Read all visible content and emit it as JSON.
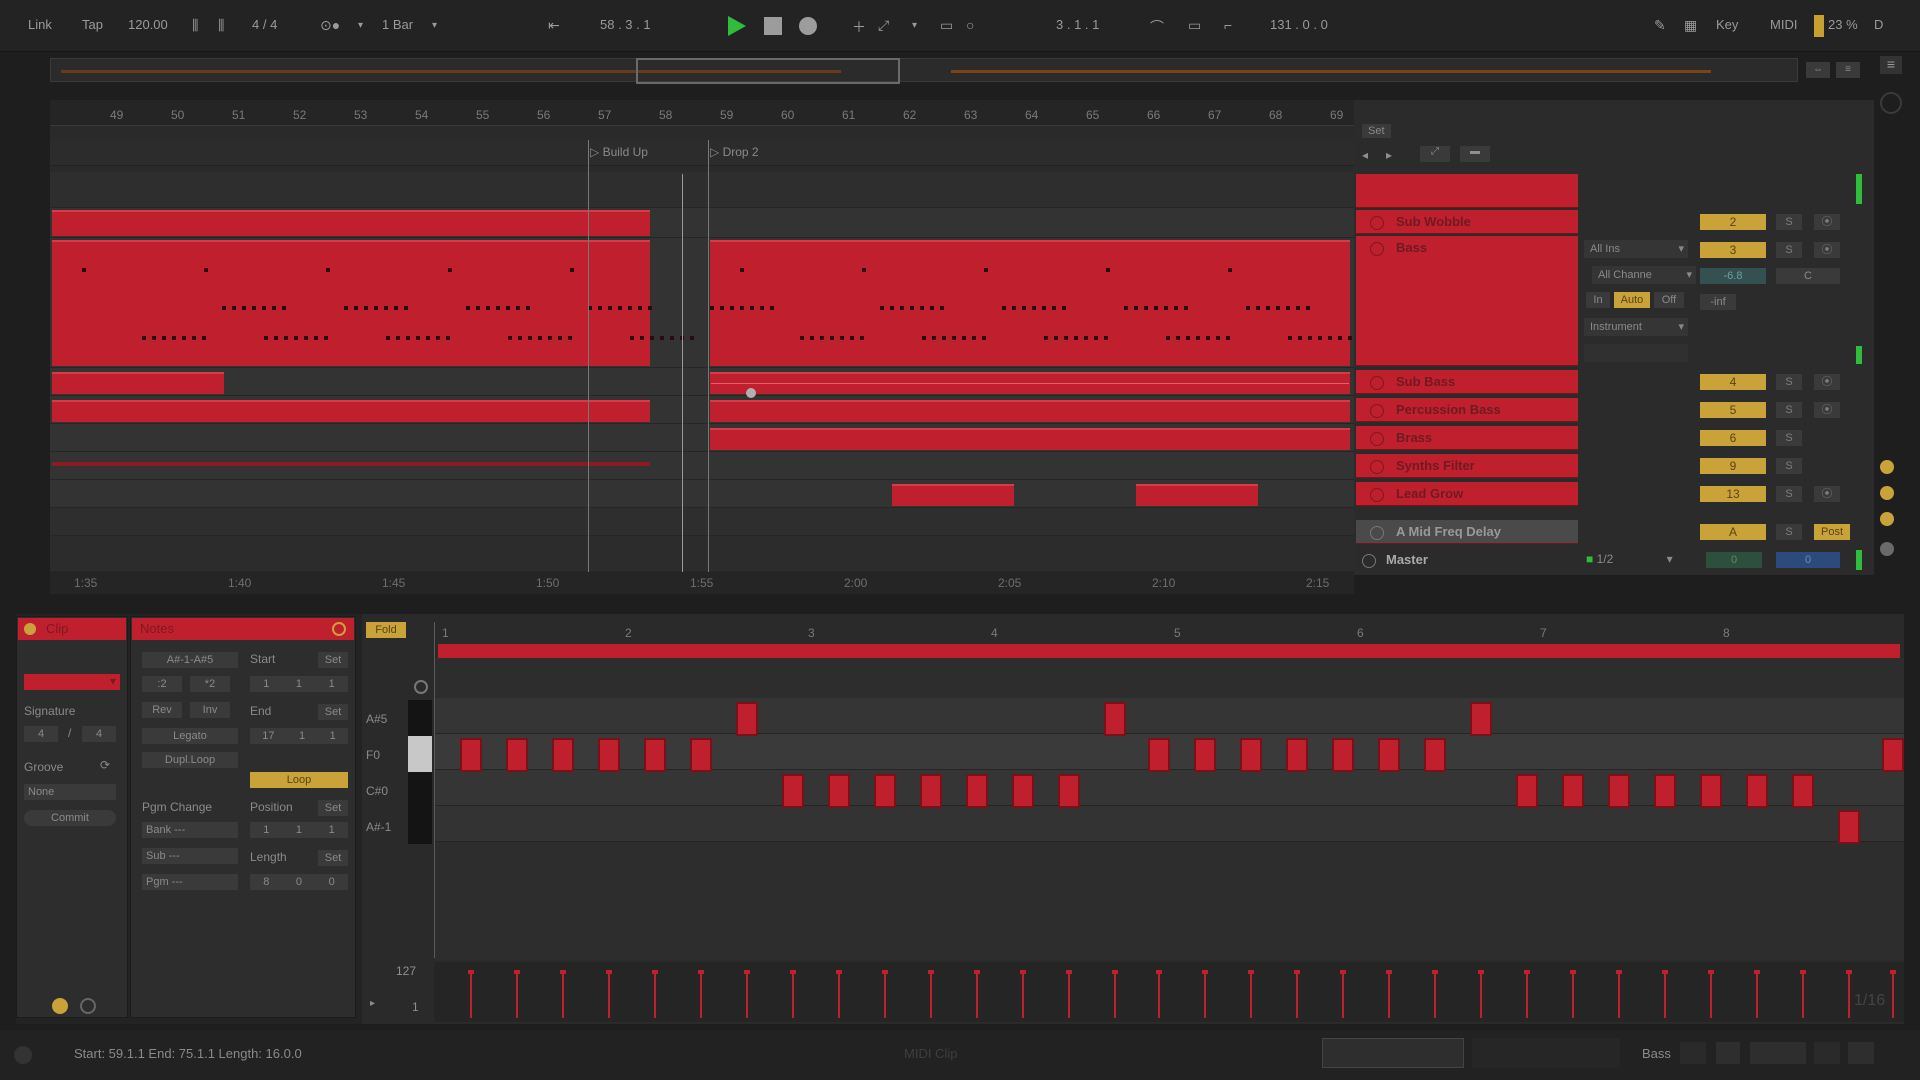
{
  "transport": {
    "link": "Link",
    "tap": "Tap",
    "tempo": "120.00",
    "time_sig": "4 / 4",
    "quantize": "1 Bar",
    "position": "58 .  3 .  1",
    "loop_start": "3 .  1 .  1",
    "loop_length": "131 .  0 .  0",
    "key": "Key",
    "midi": "MIDI",
    "cpu": "23 %",
    "disk": "D"
  },
  "arrangement": {
    "bar_numbers": [
      "49",
      "50",
      "51",
      "52",
      "53",
      "54",
      "55",
      "56",
      "57",
      "58",
      "59",
      "60",
      "61",
      "62",
      "63",
      "64",
      "65",
      "66",
      "67",
      "68",
      "69"
    ],
    "locators": [
      {
        "label": "Build Up"
      },
      {
        "label": "Drop 2"
      }
    ],
    "time_labels": [
      "1:35",
      "1:40",
      "1:45",
      "1:50",
      "1:55",
      "2:00",
      "2:05",
      "2:10",
      "2:15"
    ],
    "set_label": "Set"
  },
  "tracks": [
    {
      "name": "Sub Wobble",
      "number": "2",
      "solo": "S",
      "arm": "⦿"
    },
    {
      "name": "Bass",
      "number": "3",
      "solo": "S",
      "arm": "⦿"
    },
    {
      "name": "Sub Bass",
      "number": "4",
      "solo": "S",
      "arm": "⦿"
    },
    {
      "name": "Percussion Bass",
      "number": "5",
      "solo": "S",
      "arm": "⦿"
    },
    {
      "name": "Brass",
      "number": "6",
      "solo": "S",
      "arm": ""
    },
    {
      "name": "Synths Filter",
      "number": "9",
      "solo": "S",
      "arm": ""
    },
    {
      "name": "Lead Grow",
      "number": "13",
      "solo": "S",
      "arm": "⦿"
    },
    {
      "name": "A Mid Freq Delay",
      "number": "A",
      "solo": "S",
      "arm": "Post"
    }
  ],
  "master": {
    "name": "Master",
    "output": "1/2",
    "volume": "0",
    "pan": "0"
  },
  "bass_io": {
    "input_type": "All Ins",
    "input_channel": "All Channe",
    "monitor_in": "In",
    "monitor_auto": "Auto",
    "monitor_off": "Off",
    "output": "Instrument",
    "volume": "-6.8",
    "pan": "C",
    "send": "-inf"
  },
  "clip_panel": {
    "header": "Clip",
    "signature_label": "Signature",
    "sig_num": "4",
    "sig_den": "4",
    "groove_label": "Groove",
    "groove_value": "None",
    "commit": "Commit"
  },
  "notes_panel": {
    "header": "Notes",
    "range": "A#-1-A#5",
    "half": ":2",
    "double": "*2",
    "rev": "Rev",
    "inv": "Inv",
    "legato": "Legato",
    "dupl_loop": "Dupl.Loop",
    "start_label": "Start",
    "start_value": [
      "1",
      "1",
      "1"
    ],
    "end_label": "End",
    "end_value": [
      "17",
      "1",
      "1"
    ],
    "loop": "Loop",
    "pgm_change": "Pgm Change",
    "position_label": "Position",
    "position_value": [
      "1",
      "1",
      "1"
    ],
    "bank": "Bank ---",
    "sub": "Sub ---",
    "pgm": "Pgm ---",
    "length_label": "Length",
    "length_value": [
      "8",
      "0",
      "0"
    ],
    "set": "Set"
  },
  "piano_roll": {
    "fold": "Fold",
    "bar_numbers": [
      "1",
      "2",
      "3",
      "4",
      "5",
      "6",
      "7",
      "8"
    ],
    "keys": [
      "A#5",
      "F0",
      "C#0",
      "A#-1"
    ],
    "velocity_max": "127",
    "velocity_min": "1",
    "grid": "1/16"
  },
  "status": {
    "selection": "Start: 59.1.1  End: 75.1.1  Length: 16.0.0",
    "center": "MIDI Clip",
    "track_name": "Bass"
  }
}
